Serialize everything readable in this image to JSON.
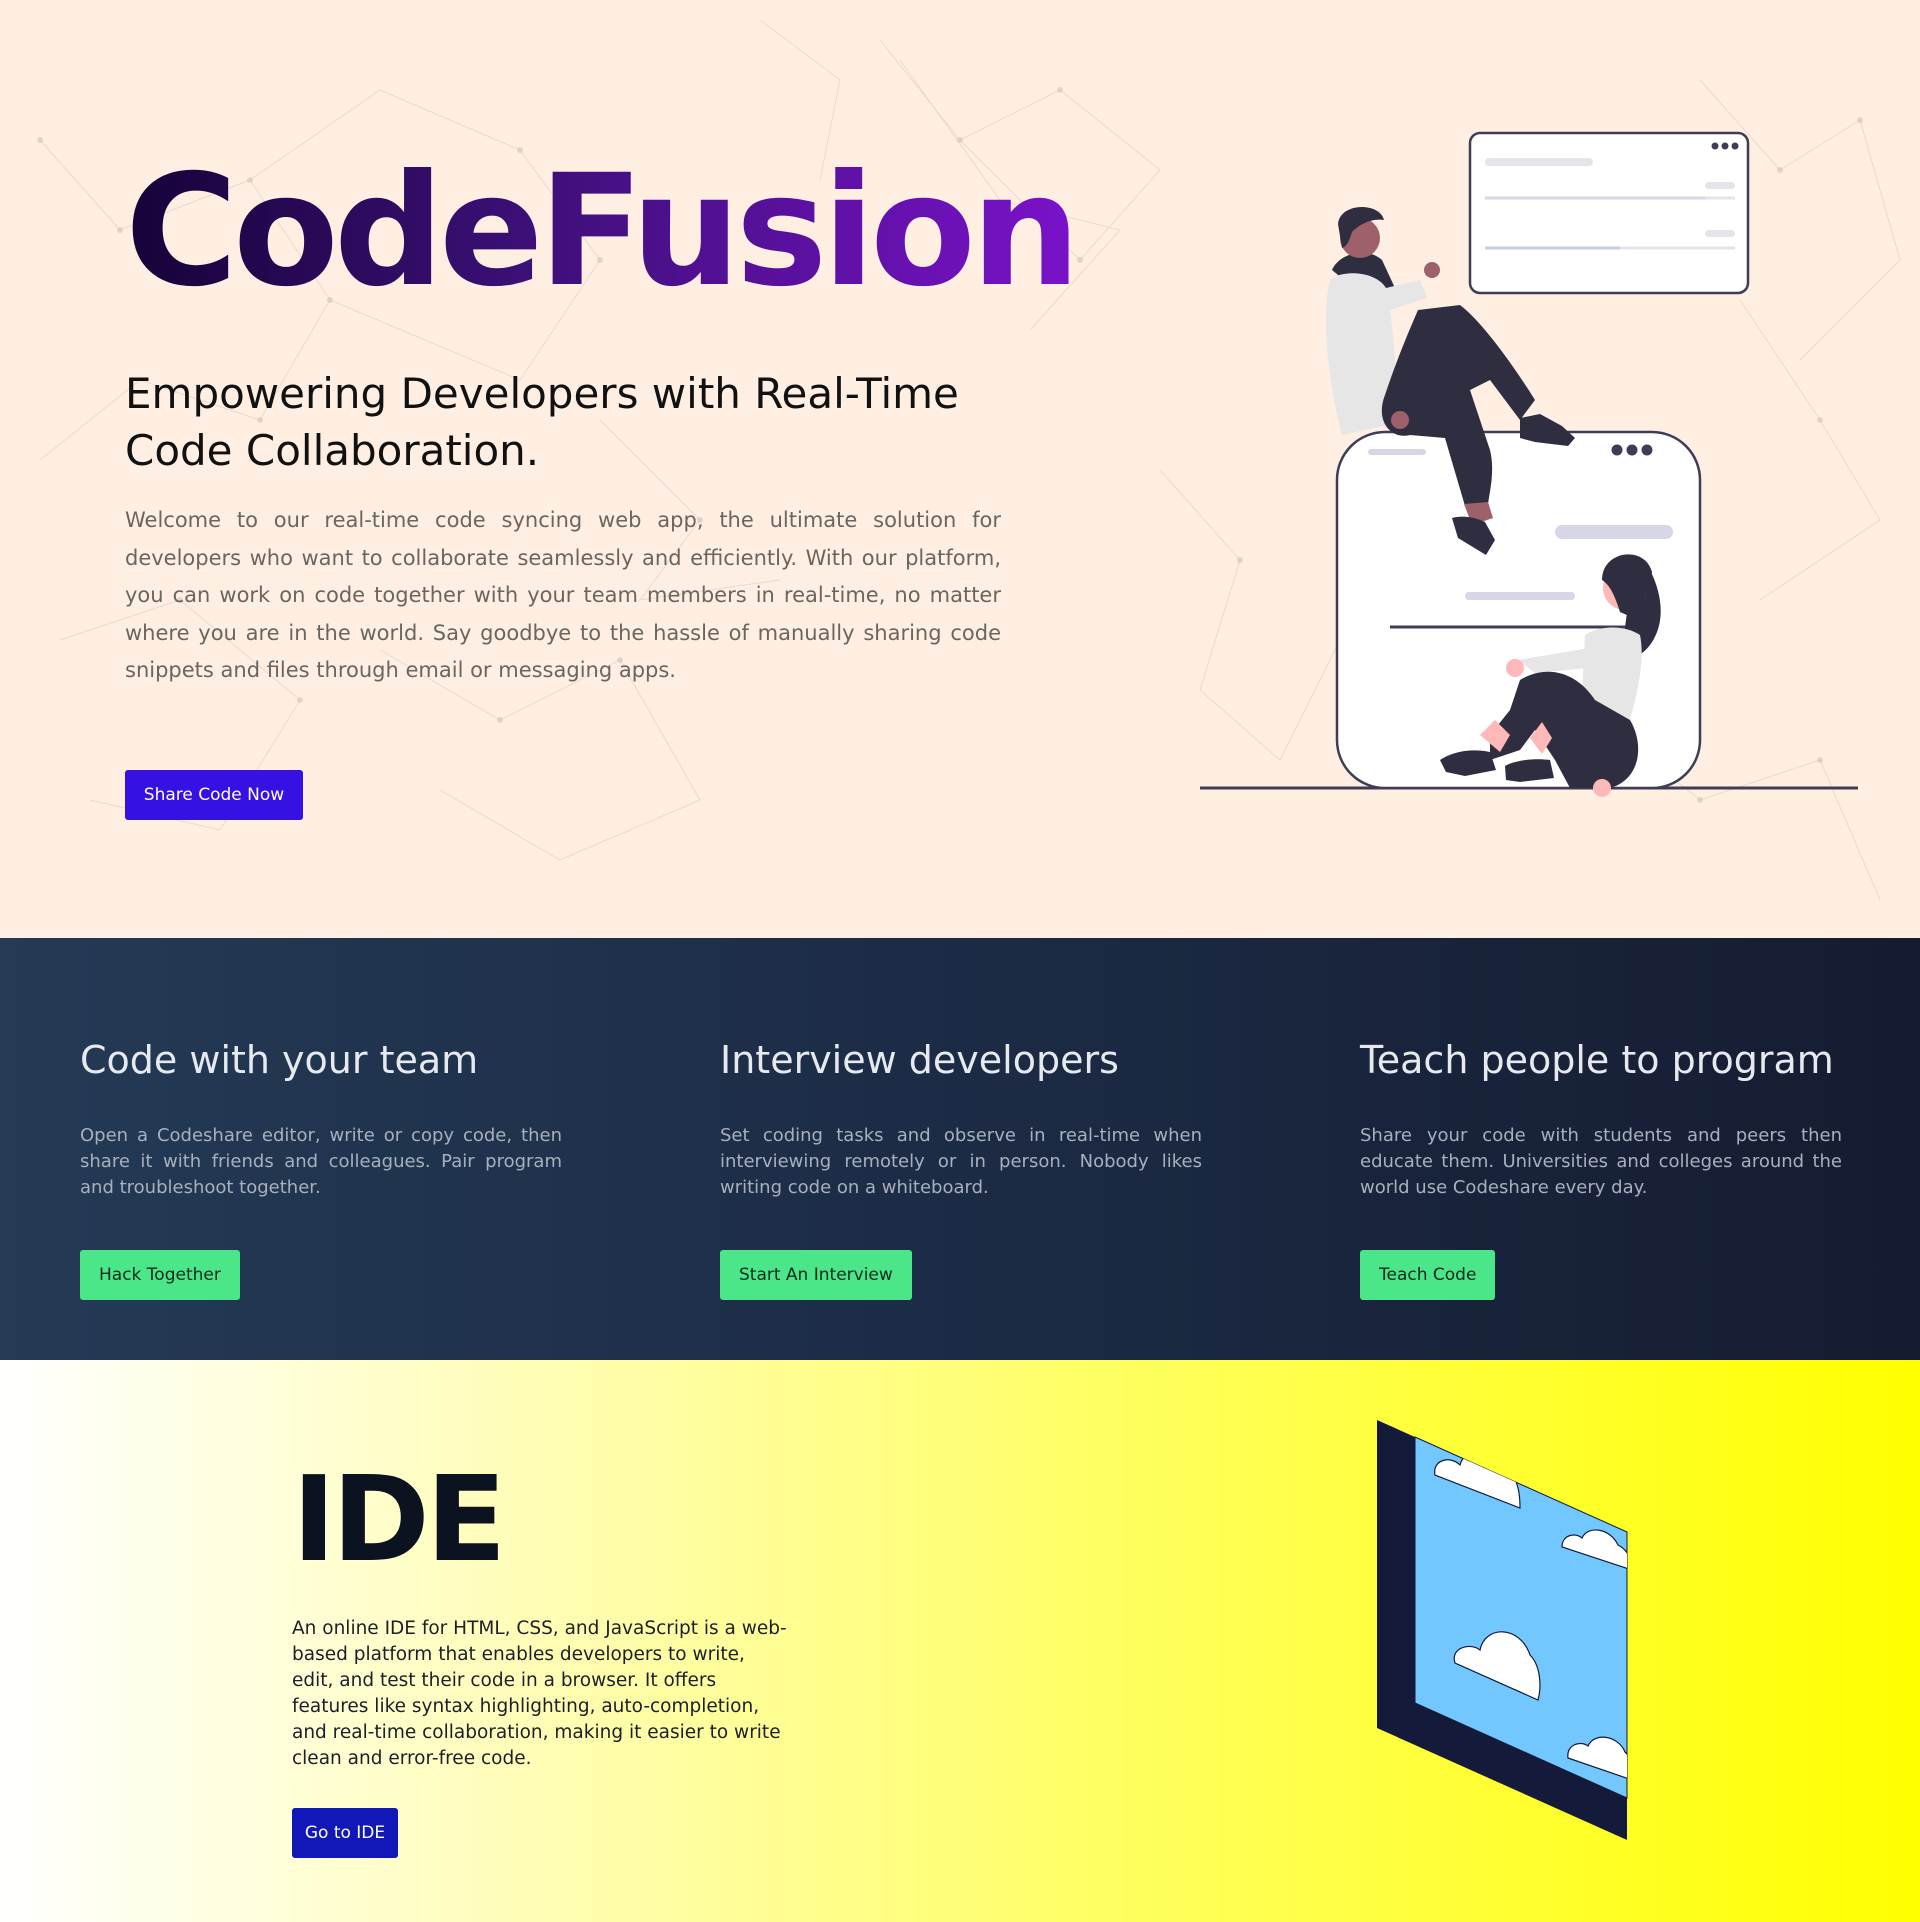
{
  "hero": {
    "title": "CodeFusion",
    "subtitle": "Empowering Developers with Real-Time Code Collaboration.",
    "body": "Welcome to our real-time code syncing web app, the ultimate solution for developers who want to collaborate seamlessly and efficiently. With our platform, you can work on code together with your team members in real-time, no matter where you are in the world. Say goodbye to the hassle of manually sharing code snippets and files through email or messaging apps.",
    "cta_label": "Share Code Now",
    "illustration": "two-people-collaborating-illustration"
  },
  "features": [
    {
      "title": "Code with your team",
      "body": "Open a Codeshare editor, write or copy code, then share it with friends and colleagues. Pair program and troubleshoot together.",
      "button_label": "Hack Together"
    },
    {
      "title": "Interview developers",
      "body": "Set coding tasks and observe in real-time when interviewing remotely or in person. Nobody likes writing code on a whiteboard.",
      "button_label": "Start An Interview"
    },
    {
      "title": "Teach people to program",
      "body": "Share your code with students and peers then educate them. Universities and colleges around the world use Codeshare every day.",
      "button_label": "Teach Code"
    }
  ],
  "ide": {
    "title": "IDE",
    "body": "An online IDE for HTML, CSS, and JavaScript is a web-based platform that enables developers to write, edit, and test their code in a browser. It offers features like syntax highlighting, auto-completion, and real-time collaboration, making it easier to write clean and error-free code.",
    "button_label": "Go to IDE",
    "illustration": "window-with-clouds-illustration"
  },
  "colors": {
    "hero_bg": "#ffefe3",
    "primary_button": "#3710e4",
    "feature_button": "#4ae689",
    "ide_button": "#1218b8",
    "title_gradient_start": "#160339",
    "title_gradient_end": "#7a12c9"
  }
}
